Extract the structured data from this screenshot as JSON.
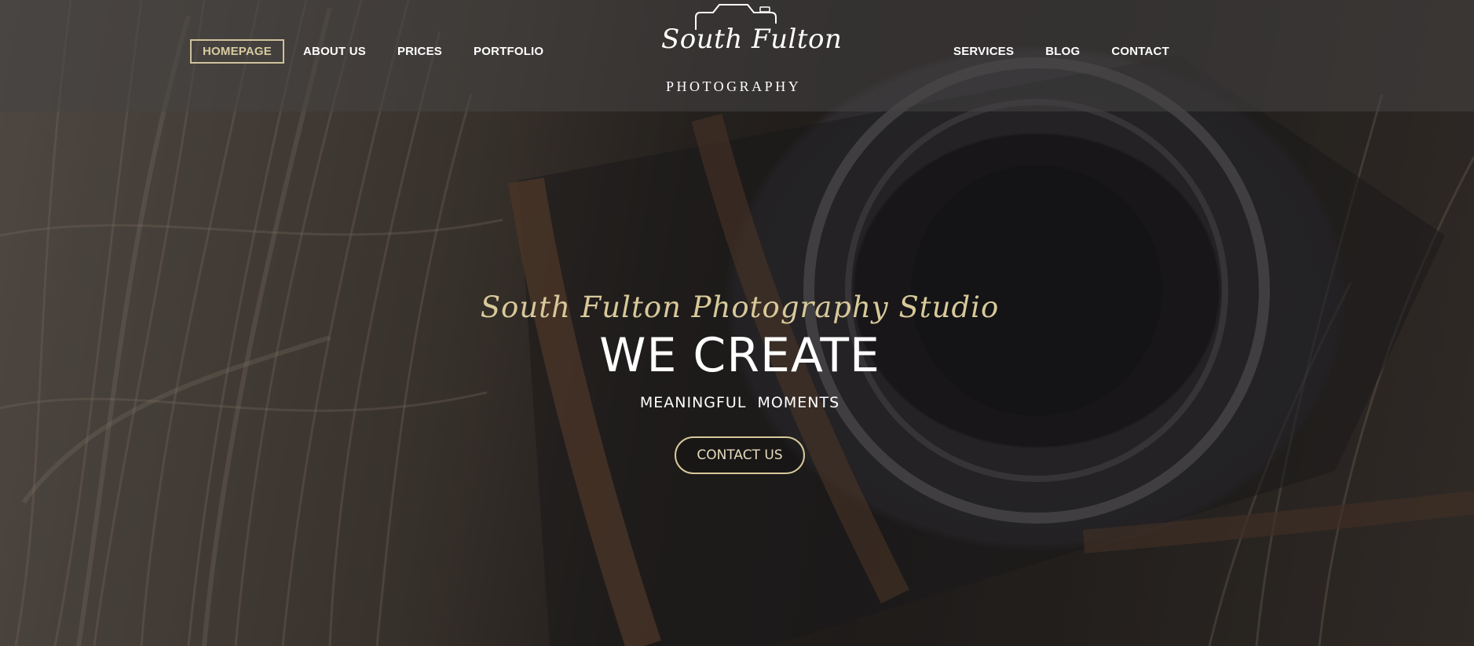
{
  "nav": {
    "left": [
      {
        "label": "HOMEPAGE",
        "active": true
      },
      {
        "label": "ABOUT US",
        "active": false
      },
      {
        "label": "PRICES",
        "active": false
      },
      {
        "label": "PORTFOLIO",
        "active": false
      }
    ],
    "right": [
      {
        "label": "SERVICES",
        "active": false
      },
      {
        "label": "BLOG",
        "active": false
      },
      {
        "label": "CONTACT",
        "active": false
      }
    ]
  },
  "logo": {
    "script": "South Fulton",
    "sub": "PHOTOGRAPHY",
    "icon": "camera-outline-icon"
  },
  "hero": {
    "script": "South Fulton Photography Studio",
    "title": "WE CREATE",
    "subtitle": "MEANINGFUL  MOMENTS",
    "cta_label": "CONTACT US"
  },
  "background": {
    "subject": "camera-on-straw-photo"
  },
  "colors": {
    "accent": "#d8c99a",
    "header_overlay": "rgba(70,68,68,0.55)",
    "text": "#ffffff"
  }
}
